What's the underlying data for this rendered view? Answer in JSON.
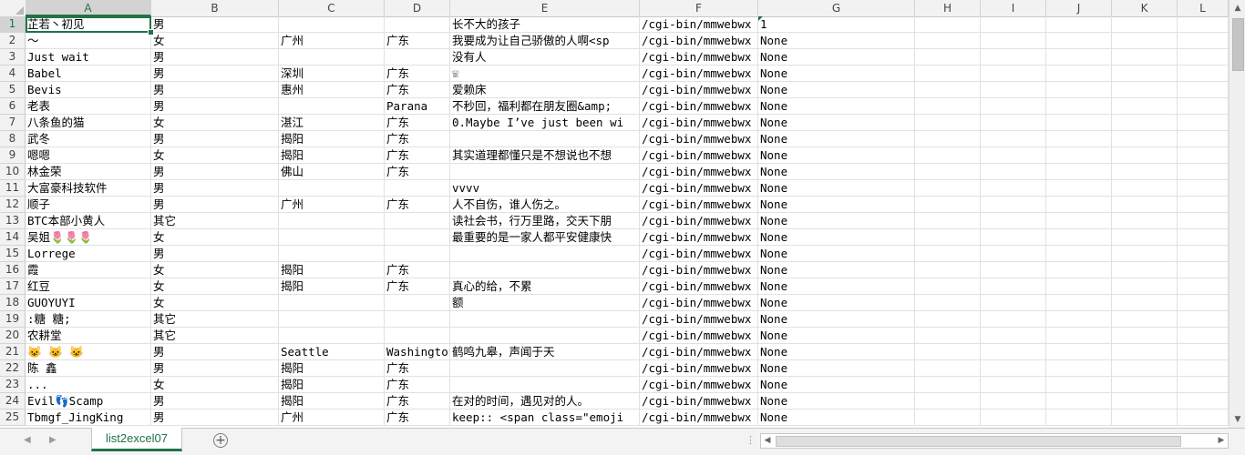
{
  "sheet": {
    "active_cell": "A1",
    "columns": [
      "A",
      "B",
      "C",
      "D",
      "E",
      "F",
      "G",
      "H",
      "I",
      "J",
      "K",
      "L"
    ],
    "rows": [
      {
        "n": "1",
        "cells": [
          "芷若丶初见",
          "男",
          "",
          "",
          "长不大的孩子",
          "/cgi-bin/mmwebwx",
          "1"
        ]
      },
      {
        "n": "2",
        "cells": [
          "～",
          "女",
          "广州",
          "广东",
          "我要成为让自己骄傲的人啊<sp",
          "/cgi-bin/mmwebwx",
          "None"
        ]
      },
      {
        "n": "3",
        "cells": [
          "Just wait",
          "男",
          "",
          "",
          "没有人",
          "/cgi-bin/mmwebwx",
          "None"
        ]
      },
      {
        "n": "4",
        "cells": [
          "Babel",
          "男",
          "深圳",
          "广东",
          "☏",
          "/cgi-bin/mmwebwx",
          "None"
        ]
      },
      {
        "n": "5",
        "cells": [
          "Bevis",
          "男",
          "惠州",
          "广东",
          "爱赖床",
          "/cgi-bin/mmwebwx",
          "None"
        ]
      },
      {
        "n": "6",
        "cells": [
          "老表",
          "男",
          "",
          "Parana",
          "不秒回，福利都在朋友圈&amp;",
          "/cgi-bin/mmwebwx",
          "None"
        ]
      },
      {
        "n": "7",
        "cells": [
          "八条鱼的猫",
          "女",
          "湛江",
          "广东",
          "0.Maybe I’ve just been wi",
          "/cgi-bin/mmwebwx",
          "None"
        ]
      },
      {
        "n": "8",
        "cells": [
          "武冬",
          "男",
          "揭阳",
          "广东",
          "",
          "/cgi-bin/mmwebwx",
          "None"
        ]
      },
      {
        "n": "9",
        "cells": [
          "嗯嗯",
          "女",
          "揭阳",
          "广东",
          "其实道理都懂只是不想说也不想",
          "/cgi-bin/mmwebwx",
          "None"
        ]
      },
      {
        "n": "10",
        "cells": [
          "林金荣",
          "男",
          "佛山",
          "广东",
          "",
          "/cgi-bin/mmwebwx",
          "None"
        ]
      },
      {
        "n": "11",
        "cells": [
          "大富豪科技软件",
          "男",
          "",
          "",
          "vvvv",
          "/cgi-bin/mmwebwx",
          "None"
        ]
      },
      {
        "n": "12",
        "cells": [
          "顺子",
          "男",
          "广州",
          "广东",
          "人不自伤，谁人伤之。",
          "/cgi-bin/mmwebwx",
          "None"
        ]
      },
      {
        "n": "13",
        "cells": [
          "BTC本部小黄人",
          "其它",
          "",
          "",
          "读社会书，行万里路，交天下朋",
          "/cgi-bin/mmwebwx",
          "None"
        ]
      },
      {
        "n": "14",
        "cells": [
          "吴姐🌷🌷🌷",
          "女",
          "",
          "",
          "最重要的是一家人都平安健康快",
          "/cgi-bin/mmwebwx",
          "None"
        ]
      },
      {
        "n": "15",
        "cells": [
          "Lorrege",
          "男",
          "",
          "",
          "",
          "/cgi-bin/mmwebwx",
          "None"
        ]
      },
      {
        "n": "16",
        "cells": [
          "霞",
          "女",
          "揭阳",
          "广东",
          "",
          "/cgi-bin/mmwebwx",
          "None"
        ]
      },
      {
        "n": "17",
        "cells": [
          "红豆",
          "女",
          "揭阳",
          "广东",
          "真心的给，不累",
          "/cgi-bin/mmwebwx",
          "None"
        ]
      },
      {
        "n": "18",
        "cells": [
          "GUOYUYI",
          "女",
          "",
          "",
          "额",
          "/cgi-bin/mmwebwx",
          "None"
        ]
      },
      {
        "n": "19",
        "cells": [
          ":糖      糖;",
          "其它",
          "",
          "",
          "",
          "/cgi-bin/mmwebwx",
          "None"
        ]
      },
      {
        "n": "20",
        "cells": [
          "农耕堂",
          "其它",
          "",
          "",
          "",
          "/cgi-bin/mmwebwx",
          "None"
        ]
      },
      {
        "n": "21",
        "cells": [
          "😺 😺 😺",
          "男",
          "Seattle",
          "Washington",
          "鹤鸣九皋，声闻于天",
          "/cgi-bin/mmwebwx",
          "None"
        ]
      },
      {
        "n": "22",
        "cells": [
          "陈    鑫",
          "男",
          "揭阳",
          "广东",
          "",
          "/cgi-bin/mmwebwx",
          "None"
        ]
      },
      {
        "n": "23",
        "cells": [
          "...",
          "女",
          "揭阳",
          "广东",
          "",
          "/cgi-bin/mmwebwx",
          "None"
        ]
      },
      {
        "n": "24",
        "cells": [
          "Evil👣Scamp",
          "男",
          "揭阳",
          "广东",
          "在对的时间，遇见对的人。",
          "/cgi-bin/mmwebwx",
          "None"
        ]
      },
      {
        "n": "25",
        "cells": [
          "Tbmgf_JingKing",
          "男",
          "广州",
          "广东",
          "keep:: <span class=\"emoji",
          "/cgi-bin/mmwebwx",
          "None"
        ]
      }
    ]
  },
  "tabs": [
    {
      "label": "list2excel07",
      "active": true
    }
  ],
  "ui": {
    "add_sheet_glyph": "⊕",
    "nav_prev_glyph": "◀",
    "nav_next_glyph": "▶",
    "dots_glyph": "⋮",
    "scroll_up_glyph": "▲",
    "scroll_down_glyph": "▼",
    "scroll_left_glyph": "◀",
    "scroll_right_glyph": "▶",
    "accent_color": "#217346"
  }
}
